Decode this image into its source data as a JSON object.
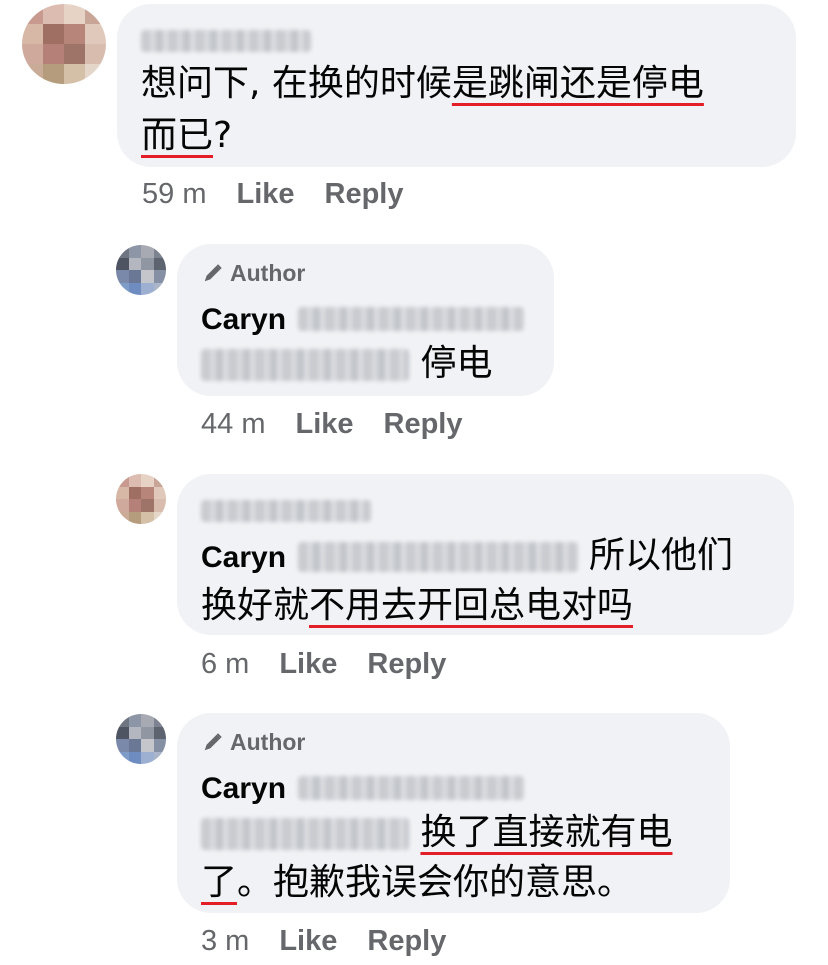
{
  "comments": [
    {
      "text_line1_plain": "想问下, 在换的时候",
      "text_line1_ul": "是跳闸还是停电",
      "text_line2_ul": "而已",
      "text_line2_plain": "?",
      "time": "59 m",
      "like": "Like",
      "reply": "Reply"
    },
    {
      "author_badge": "Author",
      "name": "Caryn",
      "text": "停电",
      "time": "44 m",
      "like": "Like",
      "reply": "Reply"
    },
    {
      "name_mention": "Caryn",
      "text_line1": "所以他们",
      "text_line2_plain": "换好就",
      "text_line2_ul": "不用去开回总电对吗",
      "time": "6 m",
      "like": "Like",
      "reply": "Reply"
    },
    {
      "author_badge": "Author",
      "name": "Caryn",
      "text_line1_ul": "换了直接就有电",
      "text_line2_ul": "了",
      "text_line2_plain": "。抱歉我误会你的意思。",
      "time": "3 m",
      "like": "Like",
      "reply": "Reply"
    }
  ],
  "colors": {
    "bubble": "#f0f2f5",
    "meta": "#65676b",
    "underline": "#e41e26"
  }
}
